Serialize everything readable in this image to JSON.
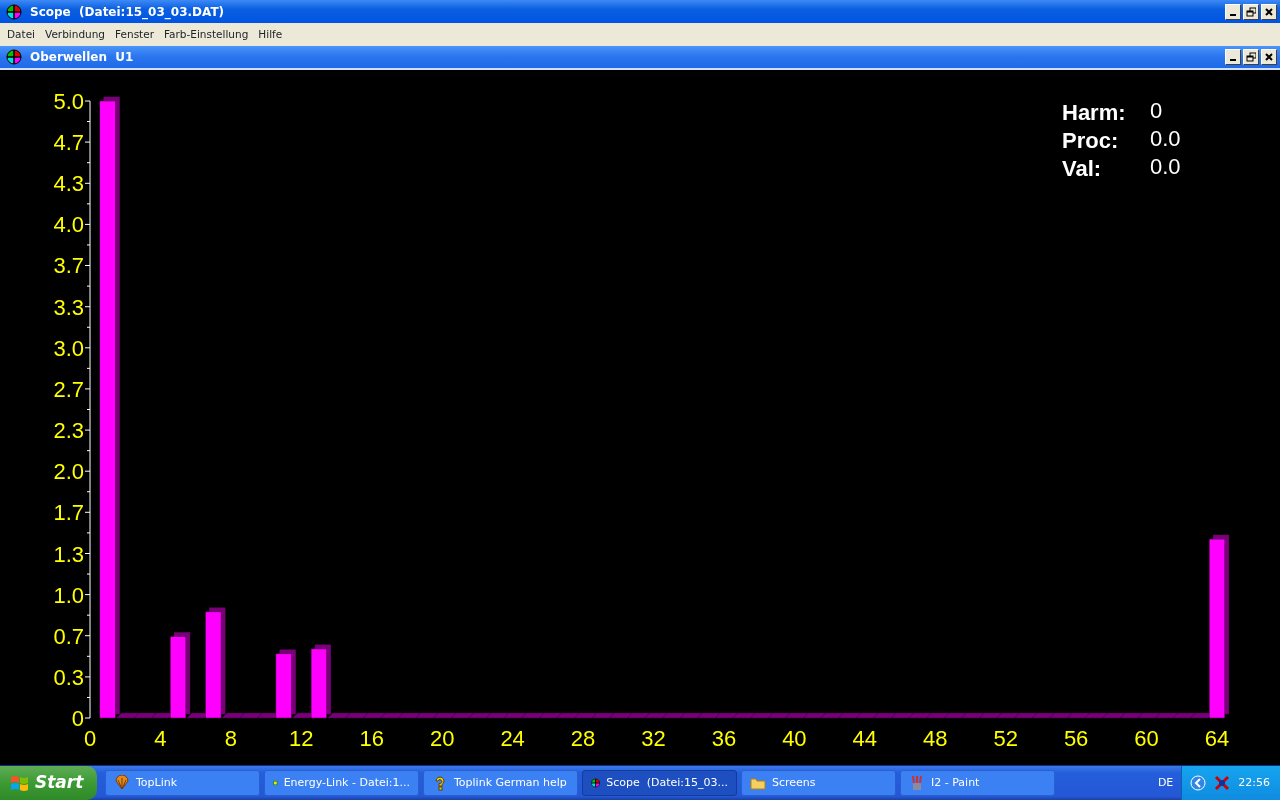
{
  "window": {
    "title": "Scope  (Datei:15_03_03.DAT)"
  },
  "menu": [
    "Datei",
    "Verbindung",
    "Fenster",
    "Farb-Einstellung",
    "Hilfe"
  ],
  "child_window": {
    "title": "Oberwellen  U1",
    "readout": [
      {
        "label": "Harm:",
        "value": "0"
      },
      {
        "label": "Proc:",
        "value": "0.0"
      },
      {
        "label": "Val:",
        "value": "0.0"
      }
    ],
    "chart_data": {
      "type": "bar",
      "xlim": [
        0,
        64
      ],
      "ylim": [
        0,
        5
      ],
      "xticks": [
        0,
        4,
        8,
        12,
        16,
        20,
        24,
        28,
        32,
        36,
        40,
        44,
        48,
        52,
        56,
        60,
        64
      ],
      "yticks": [
        0,
        {
          "value": 0.333,
          "label": "0.3"
        },
        {
          "value": 0.667,
          "label": "0.7"
        },
        {
          "value": 1,
          "label": "1.0"
        },
        {
          "value": 1.333,
          "label": "1.3"
        },
        {
          "value": 1.667,
          "label": "1.7"
        },
        {
          "value": 2,
          "label": "2.0"
        },
        {
          "value": 2.333,
          "label": "2.3"
        },
        {
          "value": 2.667,
          "label": "2.7"
        },
        {
          "value": 3,
          "label": "3.0"
        },
        {
          "value": 3.333,
          "label": "3.3"
        },
        {
          "value": 3.667,
          "label": "3.7"
        },
        {
          "value": 4,
          "label": "4.0"
        },
        {
          "value": 4.333,
          "label": "4.3"
        },
        {
          "value": 4.667,
          "label": "4.7"
        },
        {
          "value": 5,
          "label": "5.0"
        }
      ],
      "x": [
        1,
        2,
        3,
        4,
        5,
        6,
        7,
        8,
        9,
        10,
        11,
        12,
        13,
        14,
        15,
        16,
        17,
        18,
        19,
        20,
        21,
        22,
        23,
        24,
        25,
        26,
        27,
        28,
        29,
        30,
        31,
        32,
        33,
        34,
        35,
        36,
        37,
        38,
        39,
        40,
        41,
        42,
        43,
        44,
        45,
        46,
        47,
        48,
        49,
        50,
        51,
        52,
        53,
        54,
        55,
        56,
        57,
        58,
        59,
        60,
        61,
        62,
        63,
        64
      ],
      "series": [
        {
          "color": "#ff00ff",
          "values": [
            5.0,
            0,
            0,
            0,
            0.66,
            0,
            0.86,
            0,
            0,
            0,
            0.52,
            0,
            0.56,
            0,
            0,
            0,
            0,
            0,
            0,
            0,
            0,
            0,
            0,
            0,
            0,
            0,
            0,
            0,
            0,
            0,
            0,
            0,
            0,
            0,
            0,
            0,
            0,
            0,
            0,
            0,
            0,
            0,
            0,
            0,
            0,
            0,
            0,
            0,
            0,
            0,
            0,
            0,
            0,
            0,
            0,
            0,
            0,
            0,
            0,
            0,
            0,
            0,
            0,
            1.45
          ]
        }
      ]
    }
  },
  "taskbar": {
    "start": "Start",
    "tasks": [
      {
        "label": "TopLink",
        "kind": "shell",
        "selected": false
      },
      {
        "label": "Energy-Link - Datei:1...",
        "kind": "app",
        "selected": false
      },
      {
        "label": "Toplink German help",
        "kind": "help",
        "selected": false
      },
      {
        "label": "Scope  (Datei:15_03...",
        "kind": "scope",
        "selected": true
      },
      {
        "label": "Screens",
        "kind": "folder",
        "selected": false
      },
      {
        "label": "I2 - Paint",
        "kind": "paint",
        "selected": false
      }
    ],
    "language": "DE",
    "clock": "22:56"
  }
}
